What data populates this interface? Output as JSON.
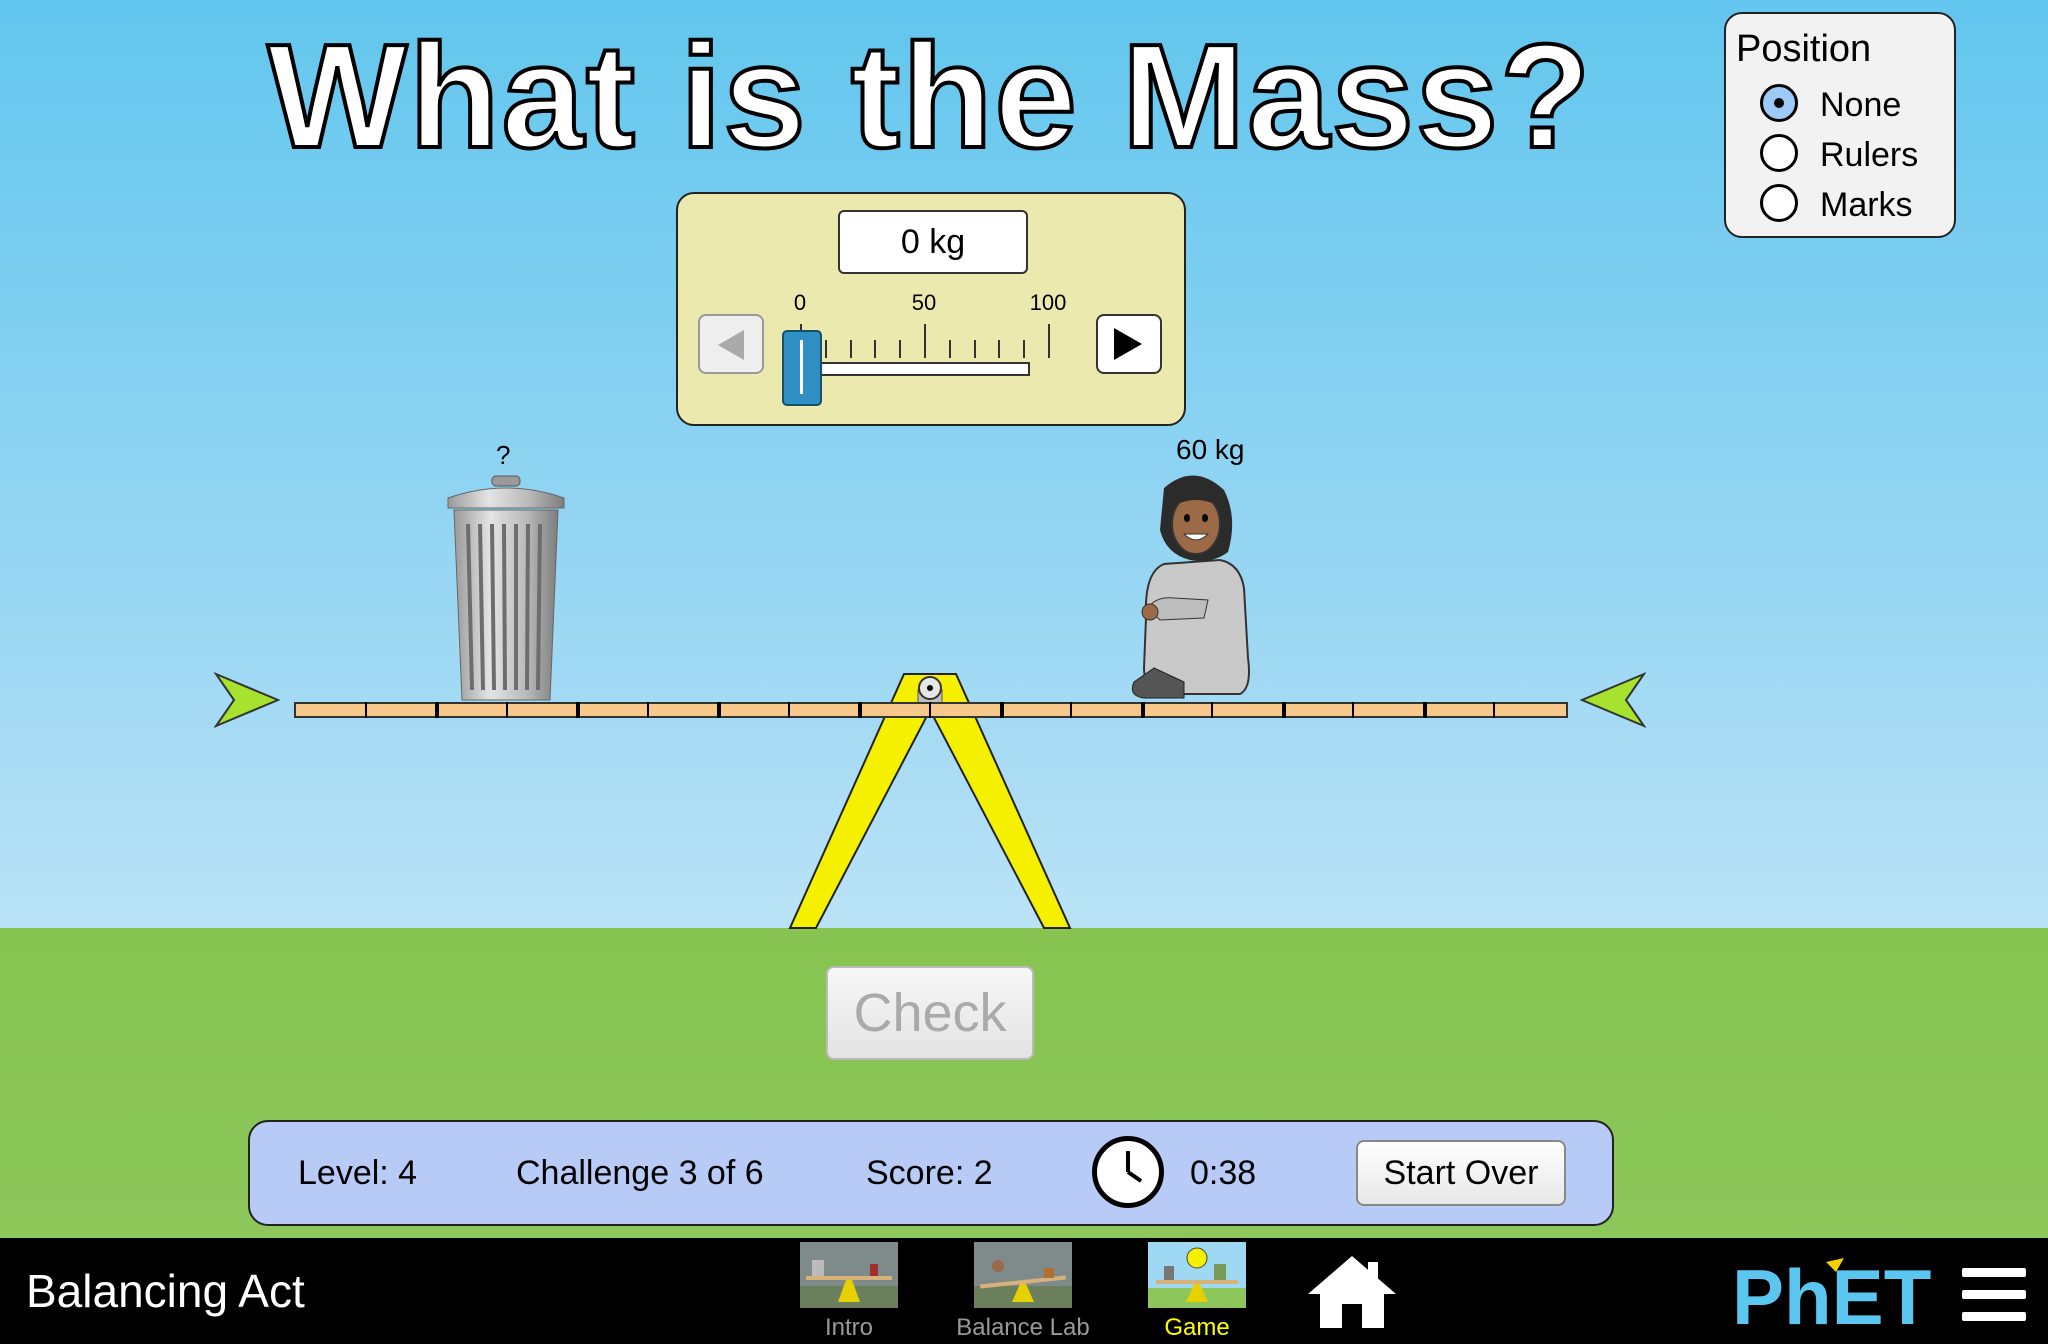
{
  "title": "What is the Mass?",
  "position_panel": {
    "title": "Position",
    "options": [
      {
        "label": "None",
        "selected": true
      },
      {
        "label": "Rulers",
        "selected": false
      },
      {
        "label": "Marks",
        "selected": false
      }
    ]
  },
  "mass_control": {
    "display": "0 kg",
    "value": 0,
    "min": 0,
    "max": 100,
    "tick_labels": [
      "0",
      "50",
      "100"
    ],
    "decrement_icon": "left-arrow-icon",
    "increment_icon": "right-arrow-icon"
  },
  "seesaw": {
    "left_object": {
      "name": "trash-can",
      "label": "?"
    },
    "right_object": {
      "name": "seated-girl",
      "label": "60 kg"
    },
    "plank_color": "#f6c98a",
    "fulcrum_color": "#f5f000",
    "indicator_color": "#a6e22e"
  },
  "check_button": {
    "label": "Check",
    "enabled": false
  },
  "status": {
    "level": "Level: 4",
    "challenge": "Challenge 3 of 6",
    "score": "Score: 2",
    "timer_icon": "clock-icon",
    "time": "0:38",
    "start_over": "Start Over"
  },
  "navbar": {
    "app_title": "Balancing Act",
    "tabs": [
      {
        "label": "Intro",
        "active": false
      },
      {
        "label": "Balance Lab",
        "active": false
      },
      {
        "label": "Game",
        "active": true
      }
    ],
    "home_icon": "home-icon",
    "logo": "PhET",
    "menu_icon": "hamburger-menu-icon"
  }
}
